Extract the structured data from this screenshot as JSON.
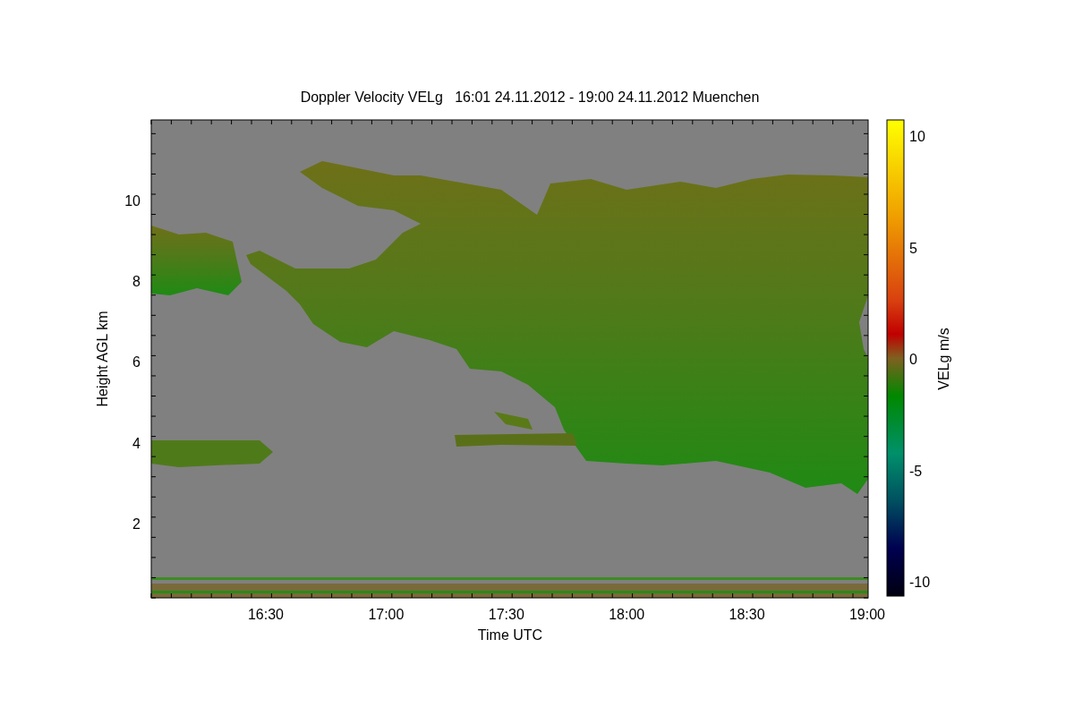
{
  "title": "Doppler Velocity VELg   16:01 24.11.2012 - 19:00 24.11.2012 Muenchen",
  "y_axis": {
    "label": "Height AGL km",
    "ticks": [
      "10",
      "8",
      "6",
      "4",
      "2"
    ]
  },
  "x_axis": {
    "label": "Time UTC",
    "ticks": [
      "16:30",
      "17:00",
      "17:30",
      "18:00",
      "18:30",
      "19:00"
    ]
  },
  "colorbar": {
    "label": "VELg m/s",
    "ticks": [
      "10",
      "5",
      "0",
      "-5",
      "-10"
    ]
  }
}
